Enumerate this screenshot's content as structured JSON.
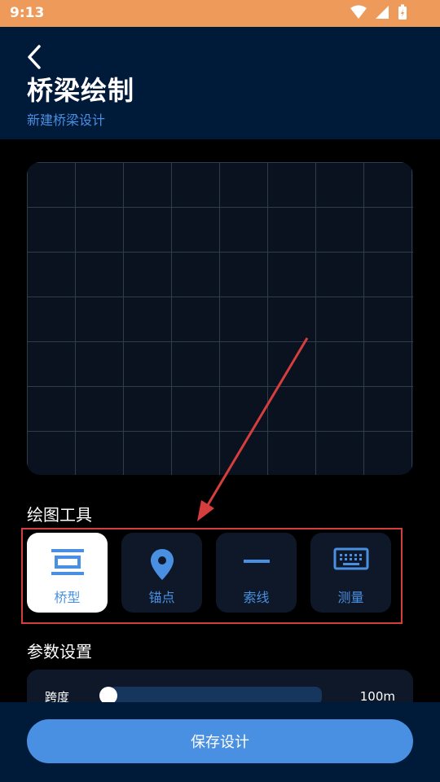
{
  "status_bar": {
    "time": "9:13"
  },
  "header": {
    "title": "桥梁绘制",
    "subtitle": "新建桥梁设计"
  },
  "tools_section": {
    "title": "绘图工具",
    "items": [
      {
        "label": "桥型",
        "icon": "bridge-type-icon",
        "active": true
      },
      {
        "label": "锚点",
        "icon": "location-pin-icon",
        "active": false
      },
      {
        "label": "索线",
        "icon": "line-icon",
        "active": false
      },
      {
        "label": "测量",
        "icon": "keyboard-icon",
        "active": false
      }
    ]
  },
  "params_section": {
    "title": "参数设置",
    "span": {
      "label": "跨度",
      "value": "100m",
      "slider_fraction": 0.0
    }
  },
  "save_button": {
    "label": "保存设计"
  },
  "colors": {
    "status_bar": "#EE9A5B",
    "header_bg": "#001A3A",
    "accent": "#4A90E2",
    "annotation_red": "#D63E3E"
  }
}
